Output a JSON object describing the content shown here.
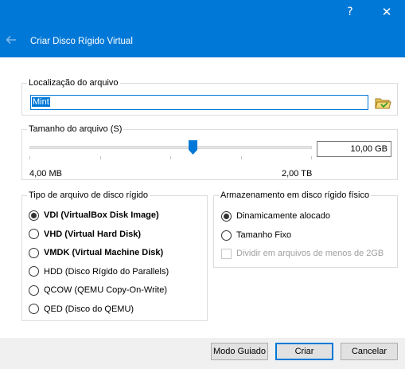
{
  "window": {
    "help_glyph": "?",
    "close_glyph": "✕"
  },
  "header": {
    "title": "Criar Disco Rígido Virtual"
  },
  "location": {
    "legend": "Localização do arquivo",
    "value": "Mint"
  },
  "size": {
    "legend": "Tamanho do arquivo (S)",
    "value": "10,00 GB",
    "min_label": "4,00 MB",
    "max_label": "2,00 TB",
    "slider_fraction": 0.58
  },
  "file_type": {
    "legend": "Tipo de arquivo de disco rígido",
    "options": [
      {
        "label": "VDI (VirtualBox Disk Image)",
        "bold": true,
        "checked": true
      },
      {
        "label": "VHD (Virtual Hard Disk)",
        "bold": true,
        "checked": false
      },
      {
        "label": "VMDK (Virtual Machine Disk)",
        "bold": true,
        "checked": false
      },
      {
        "label": "HDD (Disco Rígido do Parallels)",
        "bold": false,
        "checked": false
      },
      {
        "label": "QCOW (QEMU Copy-On-Write)",
        "bold": false,
        "checked": false
      },
      {
        "label": "QED (Disco do QEMU)",
        "bold": false,
        "checked": false
      }
    ]
  },
  "storage": {
    "legend": "Armazenamento em disco rígido físico",
    "options": [
      {
        "label": "Dinamicamente alocado",
        "checked": true
      },
      {
        "label": "Tamanho Fixo",
        "checked": false
      }
    ],
    "split_label": "Dividir em arquivos de menos de 2GB",
    "split_checked": false,
    "split_enabled": false
  },
  "buttons": {
    "guided": "Modo Guiado",
    "create": "Criar",
    "cancel": "Cancelar"
  },
  "colors": {
    "accent": "#0078d7",
    "footer_bg": "#f0f0f0"
  }
}
